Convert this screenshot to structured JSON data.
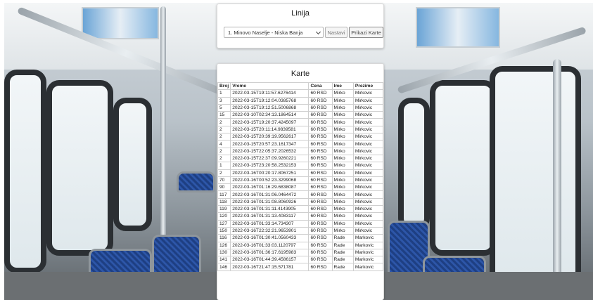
{
  "background": {
    "name": "bus-interior-photo"
  },
  "linija": {
    "title": "Linija",
    "selected_line": "1. Minovo Naselje - Niska Banja",
    "continue_label": "Nastavi",
    "show_tickets_label": "Prikazi Karte"
  },
  "karte": {
    "title": "Karte",
    "columns": [
      "Broj",
      "Vreme",
      "Cena",
      "Ime",
      "Prezime"
    ],
    "rows": [
      [
        "1",
        "2022-03-15T19:11:57.6276414",
        "60 RSD",
        "Mirko",
        "Mirkovic"
      ],
      [
        "3",
        "2022-03-15T19:12:04.0385768",
        "60 RSD",
        "Mirko",
        "Mirkovic"
      ],
      [
        "5",
        "2022-03-15T19:12:51.5006868",
        "60 RSD",
        "Mirko",
        "Mirkovic"
      ],
      [
        "15",
        "2022-03-10T02:34:13.1864514",
        "60 RSD",
        "Mirko",
        "Mirkovic"
      ],
      [
        "2",
        "2022-03-15T19:20:37.4245097",
        "60 RSD",
        "Mirko",
        "Mirkovic"
      ],
      [
        "2",
        "2022-03-15T20:11:14.9839581",
        "60 RSD",
        "Mirko",
        "Mirkovic"
      ],
      [
        "2",
        "2022-03-15T20:39:19.9562617",
        "60 RSD",
        "Mirko",
        "Mirkovic"
      ],
      [
        "4",
        "2022-03-15T20:57:23.1617347",
        "60 RSD",
        "Mirko",
        "Mirkovic"
      ],
      [
        "2",
        "2022-03-15T22:05:37.2026532",
        "60 RSD",
        "Mirko",
        "Mirkovic"
      ],
      [
        "2",
        "2022-03-15T22:37:09.9260221",
        "60 RSD",
        "Mirko",
        "Mirkovic"
      ],
      [
        "1",
        "2022-03-15T23:20:58.2532153",
        "60 RSD",
        "Mirko",
        "Mirkovic"
      ],
      [
        "2",
        "2022-03-16T00:20:17.8067251",
        "60 RSD",
        "Mirko",
        "Mirkovic"
      ],
      [
        "70",
        "2022-03-16T00:52:23.3299068",
        "60 RSD",
        "Mirko",
        "Mirkovic"
      ],
      [
        "90",
        "2022-03-16T01:16:29.6838087",
        "60 RSD",
        "Mirko",
        "Mirkovic"
      ],
      [
        "117",
        "2022-03-16T01:31:06.0464472",
        "60 RSD",
        "Mirko",
        "Mirkovic"
      ],
      [
        "118",
        "2022-03-16T01:31:08.8060926",
        "60 RSD",
        "Mirko",
        "Mirkovic"
      ],
      [
        "119",
        "2022-03-16T01:31:11.4143905",
        "60 RSD",
        "Mirko",
        "Mirkovic"
      ],
      [
        "120",
        "2022-03-16T01:31:13.4083117",
        "60 RSD",
        "Mirko",
        "Mirkovic"
      ],
      [
        "127",
        "2022-03-16T01:33:14.734307",
        "60 RSD",
        "Mirko",
        "Mirkovic"
      ],
      [
        "150",
        "2022-03-16T22:32:21.9653901",
        "60 RSD",
        "Mirko",
        "Mirkovic"
      ],
      [
        "116",
        "2022-03-16T01:30:41.0560433",
        "60 RSD",
        "Rade",
        "Markovic"
      ],
      [
        "126",
        "2022-03-16T01:33:03.1120797",
        "60 RSD",
        "Rade",
        "Markovic"
      ],
      [
        "130",
        "2022-03-16T01:36:17.6195983",
        "60 RSD",
        "Rade",
        "Markovic"
      ],
      [
        "141",
        "2022-03-16T01:44:39.4586157",
        "60 RSD",
        "Rade",
        "Markovic"
      ],
      [
        "146",
        "2022-03-16T21:47:15.571781",
        "60 RSD",
        "Rade",
        "Markovic"
      ]
    ]
  }
}
